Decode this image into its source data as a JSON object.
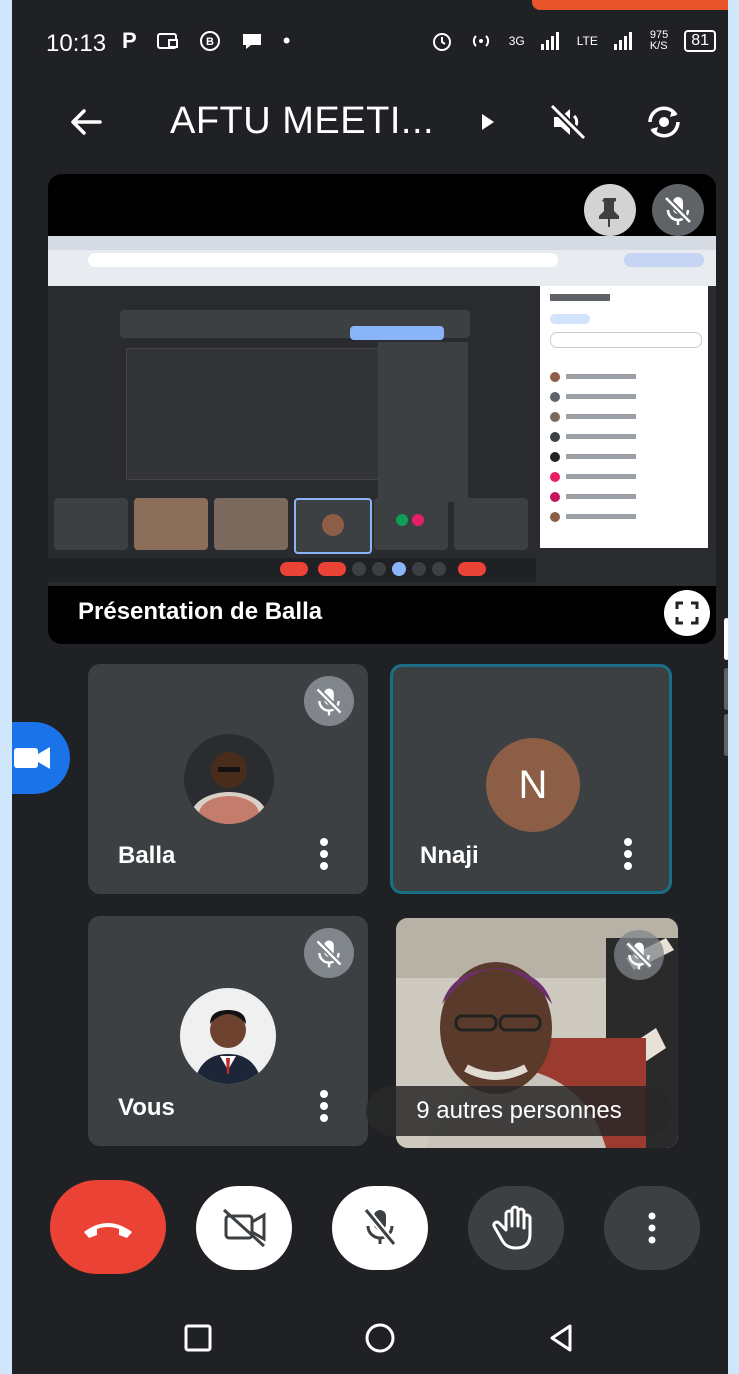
{
  "status_bar": {
    "time": "10:13",
    "left_icons": [
      "P",
      "cast-icon",
      "b-badge-icon",
      "chat-icon",
      "•"
    ],
    "right": {
      "network1": "3G",
      "network2": "LTE",
      "speed": "975\nK/S",
      "battery": "81"
    }
  },
  "header": {
    "title": "AFTU MEETI...",
    "back_icon": "arrow-left-icon",
    "audio_icon": "speaker-off-icon",
    "switch_camera_icon": "switch-camera-icon"
  },
  "presentation": {
    "label": "Présentation de Balla",
    "pin_icon": "pin-icon",
    "mute_icon": "mic-off-icon",
    "fullscreen_icon": "fullscreen-icon"
  },
  "tiles": [
    {
      "name": "Balla",
      "muted": true
    },
    {
      "name": "Nnaji",
      "initial": "N",
      "muted": false,
      "active_speaker": true
    },
    {
      "name": "Vous",
      "muted": true
    },
    {
      "name": "9 autres personnes",
      "muted": true
    }
  ],
  "controls": {
    "end_call_icon": "phone-hangup-icon",
    "camera_icon": "camera-off-icon",
    "mic_icon": "mic-off-icon",
    "hand_icon": "raise-hand-icon",
    "more_icon": "more-vert-icon"
  },
  "nav": {
    "recents_icon": "square-icon",
    "home_icon": "circle-icon",
    "back_icon": "triangle-back-icon"
  },
  "colors": {
    "background": "#202124",
    "end_call": "#ea4335",
    "avatar_n": "#8d5e46",
    "active_border": "#1b6e86",
    "accent_blue": "#1a73e8"
  }
}
